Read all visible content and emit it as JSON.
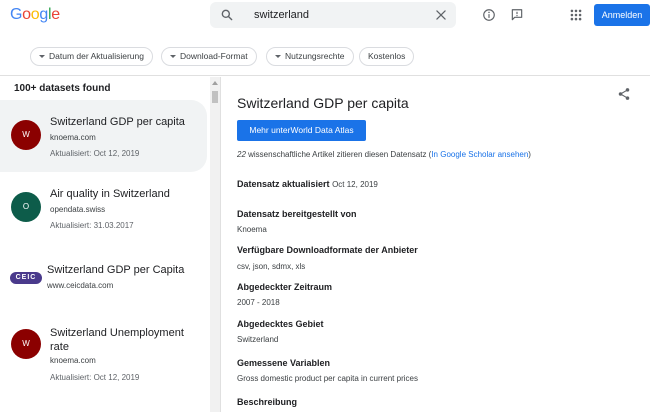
{
  "header": {
    "logo": "Google",
    "logo_colors": [
      "#4285F4",
      "#EA4335",
      "#FBBC05",
      "#4285F4",
      "#34A853",
      "#EA4335"
    ],
    "search_value": "switzerland",
    "signin_label": "Anmelden",
    "icons": [
      "search-icon",
      "clear-icon",
      "help-icon",
      "feedback-icon",
      "apps-icon"
    ]
  },
  "filters": [
    {
      "label": "Datum der Aktualisierung",
      "dropdown": true
    },
    {
      "label": "Download-Format",
      "dropdown": true
    },
    {
      "label": "Nutzungsrechte",
      "dropdown": true
    },
    {
      "label": "Kostenlos",
      "dropdown": false
    }
  ],
  "results": {
    "count_label": "100+ datasets found",
    "items": [
      {
        "title": "Switzerland GDP per capita",
        "source": "knoema.com",
        "updated": "Aktualisiert: Oct 12, 2019",
        "avatar": "W",
        "avatar_color": "#8b0000"
      },
      {
        "title": "Air quality in Switzerland",
        "source": "opendata.swiss",
        "updated": "Aktualisiert: 31.03.2017",
        "avatar": "O",
        "avatar_color": "#0d5c4a"
      },
      {
        "title": "Switzerland GDP per Capita",
        "source": "www.ceicdata.com",
        "logo": "CEIC"
      },
      {
        "title": "Switzerland Unemployment rate",
        "source": "knoema.com",
        "updated": "Aktualisiert: Oct 12, 2019",
        "avatar": "W",
        "avatar_color": "#8b0000"
      }
    ]
  },
  "detail": {
    "title": "Switzerland GDP per capita",
    "atlas_button": "Mehr unterWorld Data Atlas",
    "citations_count": "22",
    "citations_text": " wissenschaftliche Artikel zitieren diesen Datensatz (",
    "scholar_link": "In Google Scholar ansehen",
    "citations_close": ")",
    "updated_label": "Datensatz aktualisiert",
    "updated_value": "Oct 12, 2019",
    "provider_label": "Datensatz bereitgestellt von",
    "provider_value": "Knoema",
    "formats_label": "Verfügbare Downloadformate der Anbieter",
    "formats_value": "csv, json, sdmx, xls",
    "period_label": "Abgedeckter Zeitraum",
    "period_value": "2007 - 2018",
    "area_label": "Abgedecktes Gebiet",
    "area_value": "Switzerland",
    "variables_label": "Gemessene Variablen",
    "variables_value": "Gross domestic product per capita in current prices",
    "description_label": "Beschreibung"
  }
}
